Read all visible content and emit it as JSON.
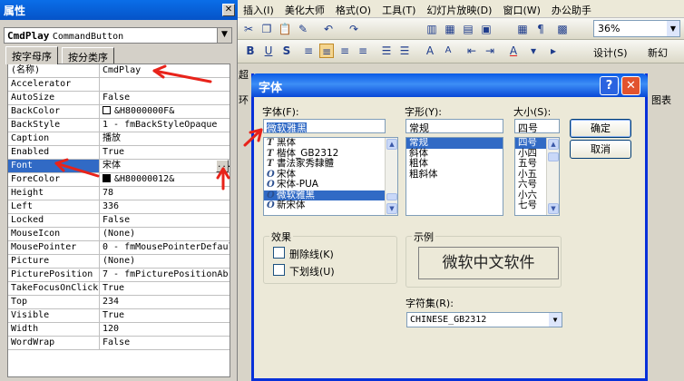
{
  "properties": {
    "title": "属性",
    "object_name": "CmdPlay",
    "object_type": "CommandButton",
    "tabs": [
      "按字母序",
      "按分类序"
    ],
    "rows": [
      {
        "name": "(名称)",
        "value": "CmdPlay"
      },
      {
        "name": "Accelerator",
        "value": ""
      },
      {
        "name": "AutoSize",
        "value": "False"
      },
      {
        "name": "BackColor",
        "value": "&H8000000F&",
        "swatch": "#ffffff"
      },
      {
        "name": "BackStyle",
        "value": "1 - fmBackStyleOpaque"
      },
      {
        "name": "Caption",
        "value": "播放"
      },
      {
        "name": "Enabled",
        "value": "True"
      },
      {
        "name": "Font",
        "value": "宋体"
      },
      {
        "name": "ForeColor",
        "value": "&H80000012&",
        "swatch": "#000000"
      },
      {
        "name": "Height",
        "value": "78"
      },
      {
        "name": "Left",
        "value": "336"
      },
      {
        "name": "Locked",
        "value": "False"
      },
      {
        "name": "MouseIcon",
        "value": "(None)"
      },
      {
        "name": "MousePointer",
        "value": "0 - fmMousePointerDefault"
      },
      {
        "name": "Picture",
        "value": "(None)"
      },
      {
        "name": "PicturePosition",
        "value": "7 - fmPicturePositionAb"
      },
      {
        "name": "TakeFocusOnClick",
        "value": "True"
      },
      {
        "name": "Top",
        "value": "234"
      },
      {
        "name": "Visible",
        "value": "True"
      },
      {
        "name": "Width",
        "value": "120"
      },
      {
        "name": "WordWrap",
        "value": "False"
      }
    ],
    "selected_row": "Font"
  },
  "menubar": [
    "插入(I)",
    "美化大师",
    "格式(O)",
    "工具(T)",
    "幻灯片放映(D)",
    "窗口(W)",
    "办公助手"
  ],
  "toolbar": {
    "zoom": "36%",
    "design_label": "设计(S)",
    "new_label": "新幻"
  },
  "font_dialog": {
    "title": "字体",
    "font_label": "字体(F):",
    "font_value": "微软雅黑",
    "fonts": [
      {
        "icon": "TT",
        "name": "黑体"
      },
      {
        "icon": "TT",
        "name": "楷体_GB2312"
      },
      {
        "icon": "TT",
        "name": "書法家秀隸體"
      },
      {
        "icon": "O",
        "name": "宋体"
      },
      {
        "icon": "O",
        "name": "宋体-PUA"
      },
      {
        "icon": "O",
        "name": "微软雅黑",
        "selected": true
      },
      {
        "icon": "O",
        "name": "新宋体"
      }
    ],
    "style_label": "字形(Y):",
    "style_value": "常规",
    "styles": [
      {
        "name": "常规",
        "selected": true
      },
      {
        "name": "斜体"
      },
      {
        "name": "粗体"
      },
      {
        "name": "粗斜体"
      }
    ],
    "size_label": "大小(S):",
    "size_value": "四号",
    "sizes": [
      {
        "name": "四号",
        "selected": true
      },
      {
        "name": "小四"
      },
      {
        "name": "五号"
      },
      {
        "name": "小五"
      },
      {
        "name": "六号"
      },
      {
        "name": "小六"
      },
      {
        "name": "七号"
      }
    ],
    "ok_label": "确定",
    "cancel_label": "取消",
    "effects_label": "效果",
    "strikeout_label": "删除线(K)",
    "underline_label": "下划线(U)",
    "sample_label": "示例",
    "sample_text": "微软中文软件",
    "charset_label": "字符集(R):",
    "charset_value": "CHINESE_GB2312"
  },
  "background_fragments": {
    "left_peek_1": "超",
    "left_peek_2": "环",
    "right_peek": "图表"
  },
  "colors": {
    "titlebar": "#0a5ae6",
    "selection": "#316ac5",
    "annotation": "#e8231a"
  }
}
